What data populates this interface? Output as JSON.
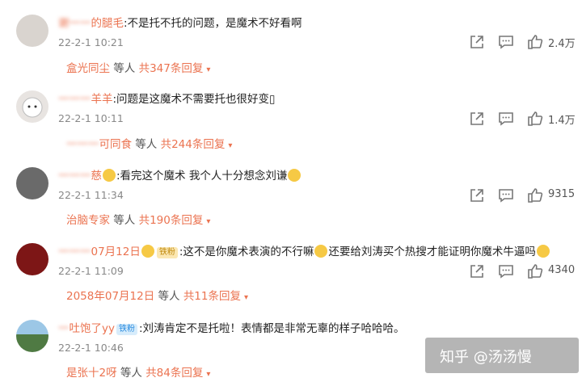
{
  "comments": [
    {
      "name_suffix": "的腿毛",
      "text": ":不是托不托的问题，是魔术不好看啊",
      "time": "22-2-1 10:21",
      "likes": "2.4万",
      "reply_name": "盒光同尘",
      "reply_mid": " 等人 ",
      "reply_count": "共347条回复"
    },
    {
      "name_suffix": "羊羊",
      "text": ":问题是这魔术不需要托也很好变▯",
      "time": "22-2-1 10:11",
      "likes": "1.4万",
      "reply_name": "可同食",
      "reply_mid": " 等人 ",
      "reply_count": "共244条回复"
    },
    {
      "name_suffix": "慈",
      "text_a": ":看完这个魔术 我个人十分想念刘谦",
      "time": "22-2-1 11:34",
      "likes": "9315",
      "reply_name": "治脑专家",
      "reply_mid": " 等人 ",
      "reply_count": "共190条回复"
    },
    {
      "name_suffix": "07月12日",
      "badge": "铁粉",
      "text_a": ":这不是你魔术表演的不行嘛",
      "text_b": "还要给刘涛买个热搜才能证明你魔术牛逼吗",
      "time": "22-2-1 11:09",
      "likes": "4340",
      "reply_name": "2058年07月12日",
      "reply_mid": " 等人 ",
      "reply_count": "共11条回复"
    },
    {
      "name_suffix": "吐饱了yy",
      "badge": "铁粉",
      "text": ":刘涛肯定不是托啦！表情都是非常无辜的样子哈哈哈。",
      "time": "22-2-1 10:46",
      "reply_name": "是张十2呀",
      "reply_mid": " 等人 ",
      "reply_count": "共84条回复"
    }
  ],
  "reply_caret": "▾",
  "watermark": "知乎 @汤汤慢",
  "icons": [
    "share-icon",
    "comment-icon",
    "like-icon"
  ],
  "colors": {
    "accent": "#eb7350",
    "muted": "#888888"
  }
}
